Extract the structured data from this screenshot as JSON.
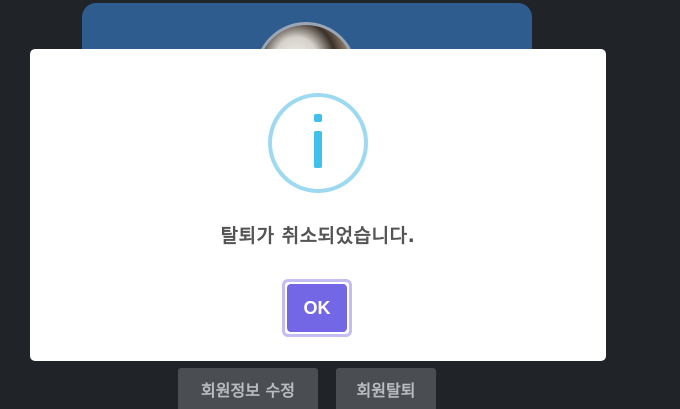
{
  "background": {
    "buttons": {
      "edit_label": "회원정보 수정",
      "withdraw_label": "회원탈퇴"
    }
  },
  "dialog": {
    "icon": "info-icon",
    "message": "탈퇴가 취소되었습니다.",
    "ok_label": "OK"
  },
  "colors": {
    "backdrop": "#202327",
    "card": "#2f5c8f",
    "icon_ring": "#9ddaf1",
    "icon_glyph": "#3fc1ec",
    "ok_button": "#7367e6",
    "message_text": "#545454"
  }
}
